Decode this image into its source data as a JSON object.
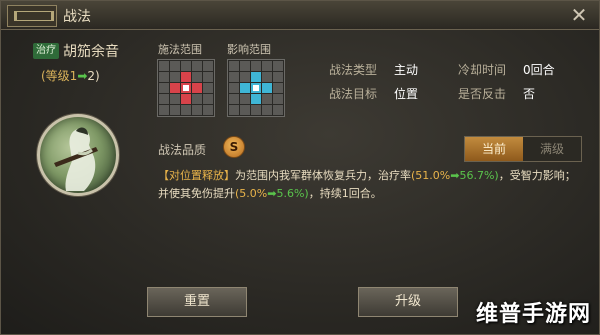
{
  "window": {
    "title": "战法"
  },
  "skill": {
    "tag": "治疗",
    "name": "胡笳余音",
    "level_prefix": "(等级1",
    "level_arrow": "➡",
    "level_to": "2)"
  },
  "ranges": {
    "cast_label": "施法范围",
    "effect_label": "影响范围"
  },
  "stats": {
    "type_label": "战法类型",
    "type_value": "主动",
    "cooldown_label": "冷却时间",
    "cooldown_value": "0回合",
    "target_label": "战法目标",
    "target_value": "位置",
    "counter_label": "是否反击",
    "counter_value": "否"
  },
  "quality": {
    "label": "战法品质",
    "grade": "S"
  },
  "tabs": {
    "current": "当前",
    "max": "满级"
  },
  "description": {
    "tag": "【对位置释放】",
    "part1": "为范围内我军群体恢复兵力，治疗率",
    "heal_old": "(51.0%",
    "arrow": "➡",
    "heal_new": "56.7%)",
    "part2": "，受智力影响；并使其免伤提升",
    "dr_old": "(5.0%",
    "dr_new": "5.6%)",
    "part3": "，持续1回合。"
  },
  "buttons": {
    "reset": "重置",
    "upgrade": "升级"
  },
  "watermark": "维普手游网",
  "colors": {
    "cast_range": "#d8434a",
    "effect_range": "#3fb6d6",
    "accent_tab": "#c28b3e",
    "heal_tag": "#2f6b39"
  },
  "icons": {
    "close": "close-icon",
    "portrait": "guqin-player-portrait"
  }
}
